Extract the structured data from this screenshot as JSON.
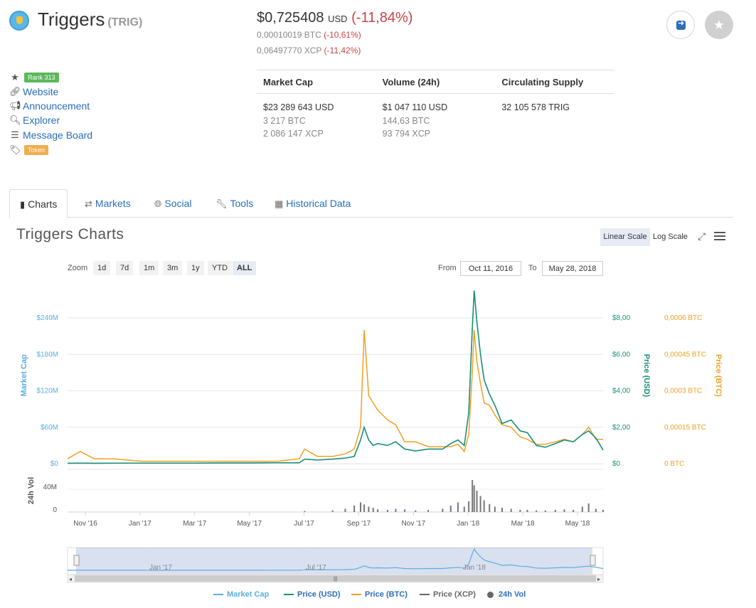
{
  "coin": {
    "name": "Triggers",
    "symbol": "(TRIG)"
  },
  "price": {
    "usd": "$0,725408",
    "usd_unit": "USD",
    "usd_change": "(-11,84%)",
    "btc": "0,00010019 BTC",
    "btc_change": "(-10,61%)",
    "xcp": "0,06497770 XCP",
    "xcp_change": "(-11,42%)"
  },
  "links": {
    "rank": "Rank 313",
    "website": "Website",
    "announcement": "Announcement",
    "explorer": "Explorer",
    "message_board": "Message Board",
    "tag": "Token"
  },
  "stats": {
    "headers": [
      "Market Cap",
      "Volume (24h)",
      "Circulating Supply"
    ],
    "market_cap": [
      "$23 289 643 USD",
      "3 217 BTC",
      "2 086 147 XCP"
    ],
    "volume": [
      "$1 047 110 USD",
      "144,63 BTC",
      "93 794 XCP"
    ],
    "supply": [
      "32 105 578 TRIG"
    ]
  },
  "tabs": [
    "Charts",
    "Markets",
    "Social",
    "Tools",
    "Historical Data"
  ],
  "chart_panel": {
    "title": "Triggers Charts",
    "linear_scale": "Linear Scale",
    "log_scale": "Log Scale",
    "zoom_label": "Zoom",
    "zoom_options": [
      "1d",
      "7d",
      "1m",
      "3m",
      "1y",
      "YTD",
      "ALL"
    ],
    "zoom_selected": "ALL",
    "from_label": "From",
    "from_value": "Oct 11, 2016",
    "to_label": "To",
    "to_value": "May 28, 2018"
  },
  "colors": {
    "market_cap": "#5aaee0",
    "price_usd": "#1a9073",
    "price_btc": "#f0a024",
    "price_xcp": "#666666",
    "volume": "#777777"
  },
  "chart_data": {
    "type": "line",
    "x_ticks": [
      "Nov '16",
      "Jan '17",
      "Mar '17",
      "May '17",
      "Jul '17",
      "Sep '17",
      "Nov '17",
      "Jan '18",
      "Mar '18",
      "May '18"
    ],
    "navigator_ticks": [
      "Jan '17",
      "Jul '17",
      "Jan '18"
    ],
    "y_left_label": "Market Cap",
    "y_left_ticks": [
      "$0",
      "$60M",
      "$120M",
      "$180M",
      "$240M"
    ],
    "y_right1_label": "Price (USD)",
    "y_right1_ticks": [
      "$0",
      "$2,00",
      "$4,00",
      "$6,00",
      "$8,00"
    ],
    "y_right2_label": "Price (BTC)",
    "y_right2_ticks": [
      "0 BTC",
      "0,00015 BTC",
      "0,0003 BTC",
      "0,00045 BTC",
      "0,0006 BTC"
    ],
    "volume_label": "24h Vol",
    "volume_ticks": [
      "0",
      "40M"
    ],
    "ylim_usd": [
      0,
      8
    ],
    "ylim_btc": [
      0,
      0.0006
    ],
    "ylim_volume": [
      0,
      80
    ],
    "x": [
      "2016-10-11",
      "2016-10-25",
      "2016-11-10",
      "2016-12-01",
      "2017-01-01",
      "2017-02-01",
      "2017-03-01",
      "2017-04-01",
      "2017-05-01",
      "2017-06-01",
      "2017-06-25",
      "2017-07-01",
      "2017-07-15",
      "2017-08-01",
      "2017-08-15",
      "2017-08-25",
      "2017-09-01",
      "2017-09-05",
      "2017-09-10",
      "2017-09-15",
      "2017-09-20",
      "2017-10-01",
      "2017-10-10",
      "2017-10-20",
      "2017-11-01",
      "2017-11-15",
      "2017-12-01",
      "2017-12-10",
      "2017-12-18",
      "2017-12-25",
      "2017-12-30",
      "2018-01-03",
      "2018-01-05",
      "2018-01-08",
      "2018-01-12",
      "2018-01-16",
      "2018-01-22",
      "2018-01-28",
      "2018-02-05",
      "2018-02-15",
      "2018-02-25",
      "2018-03-05",
      "2018-03-15",
      "2018-03-25",
      "2018-04-05",
      "2018-04-15",
      "2018-04-25",
      "2018-05-05",
      "2018-05-12",
      "2018-05-20",
      "2018-05-28"
    ],
    "series": [
      {
        "name": "Price (USD)",
        "values": [
          0.02,
          0.03,
          0.02,
          0.03,
          0.03,
          0.03,
          0.03,
          0.04,
          0.04,
          0.05,
          0.05,
          0.25,
          0.2,
          0.25,
          0.3,
          0.4,
          1.3,
          2.0,
          1.3,
          1.0,
          1.1,
          1.0,
          1.2,
          0.8,
          0.7,
          0.8,
          0.8,
          1.1,
          1.3,
          1.0,
          2.8,
          7.5,
          9.5,
          7.8,
          6.0,
          4.6,
          3.8,
          3.2,
          2.2,
          2.4,
          1.8,
          1.7,
          1.0,
          0.9,
          1.1,
          1.3,
          1.2,
          1.6,
          1.8,
          1.4,
          0.75
        ]
      },
      {
        "name": "Price (BTC)",
        "values": [
          2e-05,
          5e-05,
          2e-05,
          2e-05,
          1e-05,
          1e-05,
          1e-05,
          1e-05,
          1e-05,
          1e-05,
          2e-05,
          6e-05,
          3e-05,
          3e-05,
          4e-05,
          6e-05,
          0.00015,
          0.00055,
          0.00028,
          0.00025,
          0.00022,
          0.00018,
          0.00016,
          9e-05,
          9e-05,
          7e-05,
          7e-05,
          7e-05,
          8e-05,
          5e-05,
          0.00012,
          0.00038,
          0.00055,
          0.00042,
          0.00033,
          0.00025,
          0.00024,
          0.0002,
          0.00016,
          0.00015,
          0.00011,
          0.0001,
          8e-05,
          8e-05,
          9e-05,
          0.0001,
          9e-05,
          0.00012,
          0.00015,
          0.0001,
          0.0001
        ]
      },
      {
        "name": "24h Vol",
        "values": [
          0,
          0,
          0,
          0,
          0,
          0,
          0,
          0,
          0,
          0,
          0,
          2,
          0,
          3,
          6,
          12,
          18,
          14,
          10,
          8,
          5,
          4,
          6,
          5,
          3,
          4,
          6,
          12,
          18,
          10,
          20,
          60,
          50,
          40,
          30,
          22,
          15,
          10,
          8,
          6,
          4,
          4,
          3,
          3,
          4,
          5,
          4,
          10,
          16,
          6,
          4
        ]
      }
    ]
  },
  "legend": [
    "Market Cap",
    "Price (USD)",
    "Price (BTC)",
    "Price (XCP)",
    "24h Vol"
  ]
}
